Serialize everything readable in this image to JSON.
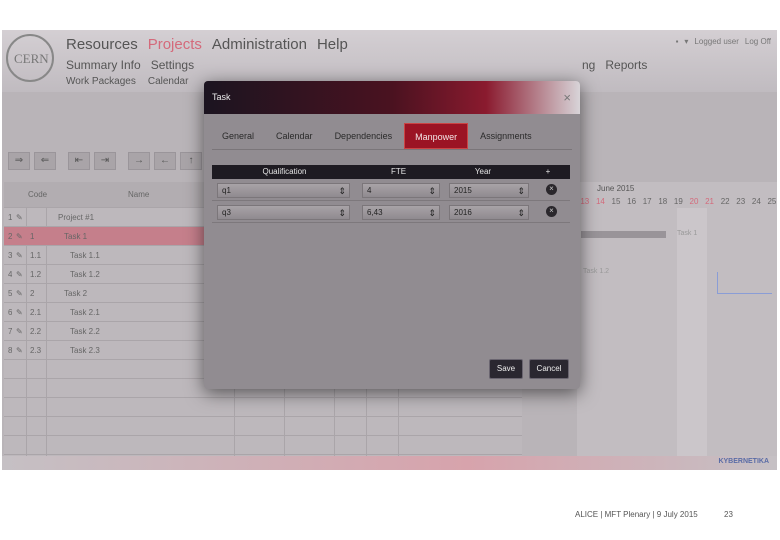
{
  "header": {
    "logo_text": "CERN",
    "main_nav": [
      "Resources",
      "Projects",
      "Administration",
      "Help"
    ],
    "sub_nav": [
      "Summary Info",
      "Settings"
    ],
    "sub_nav2": [
      "Work Packages",
      "Calendar"
    ],
    "right_nav": [
      "ng",
      "Reports"
    ],
    "top_right": {
      "flag": "▾",
      "logged_user": "Logged user",
      "logoff": "Log Off"
    }
  },
  "toolbar": [
    "⇒",
    "⇐",
    "⇤",
    "⇥",
    "→",
    "←",
    "↑"
  ],
  "grid": {
    "headers": [
      "Code",
      "Name"
    ],
    "rows": [
      {
        "num": "1",
        "code": "",
        "name": "Project #1"
      },
      {
        "num": "2",
        "code": "1",
        "name": "Task 1"
      },
      {
        "num": "3",
        "code": "1.1",
        "name": "Task 1.1"
      },
      {
        "num": "4",
        "code": "1.2",
        "name": "Task 1.2"
      },
      {
        "num": "5",
        "code": "2",
        "name": "Task 2"
      },
      {
        "num": "6",
        "code": "2.1",
        "name": "Task 2.1"
      },
      {
        "num": "7",
        "code": "2.2",
        "name": "Task 2.2"
      },
      {
        "num": "8",
        "code": "2.3",
        "name": "Task 2.3"
      }
    ]
  },
  "gantt": {
    "month": "June 2015",
    "days": [
      "13",
      "14",
      "15",
      "16",
      "17",
      "18",
      "19",
      "20",
      "21",
      "22",
      "23",
      "24",
      "25"
    ],
    "bar_label": "Task 1",
    "label2": "Task 1.2"
  },
  "bottom_logo": "KYBERNETIKA",
  "modal": {
    "title": "Task",
    "close": "×",
    "tabs": [
      "General",
      "Calendar",
      "Dependencies",
      "Manpower",
      "Assignments"
    ],
    "active_tab": "Manpower",
    "table": {
      "headers": [
        "Qualification",
        "FTE",
        "Year"
      ],
      "add_icon": "+",
      "rows": [
        {
          "qualification": "q1",
          "fte": "4",
          "year": "2015"
        },
        {
          "qualification": "q3",
          "fte": "6,43",
          "year": "2016"
        }
      ]
    },
    "save_label": "Save",
    "cancel_label": "Cancel"
  },
  "footer": {
    "text": "ALICE | MFT Plenary | 9 July 2015",
    "page": "23"
  }
}
